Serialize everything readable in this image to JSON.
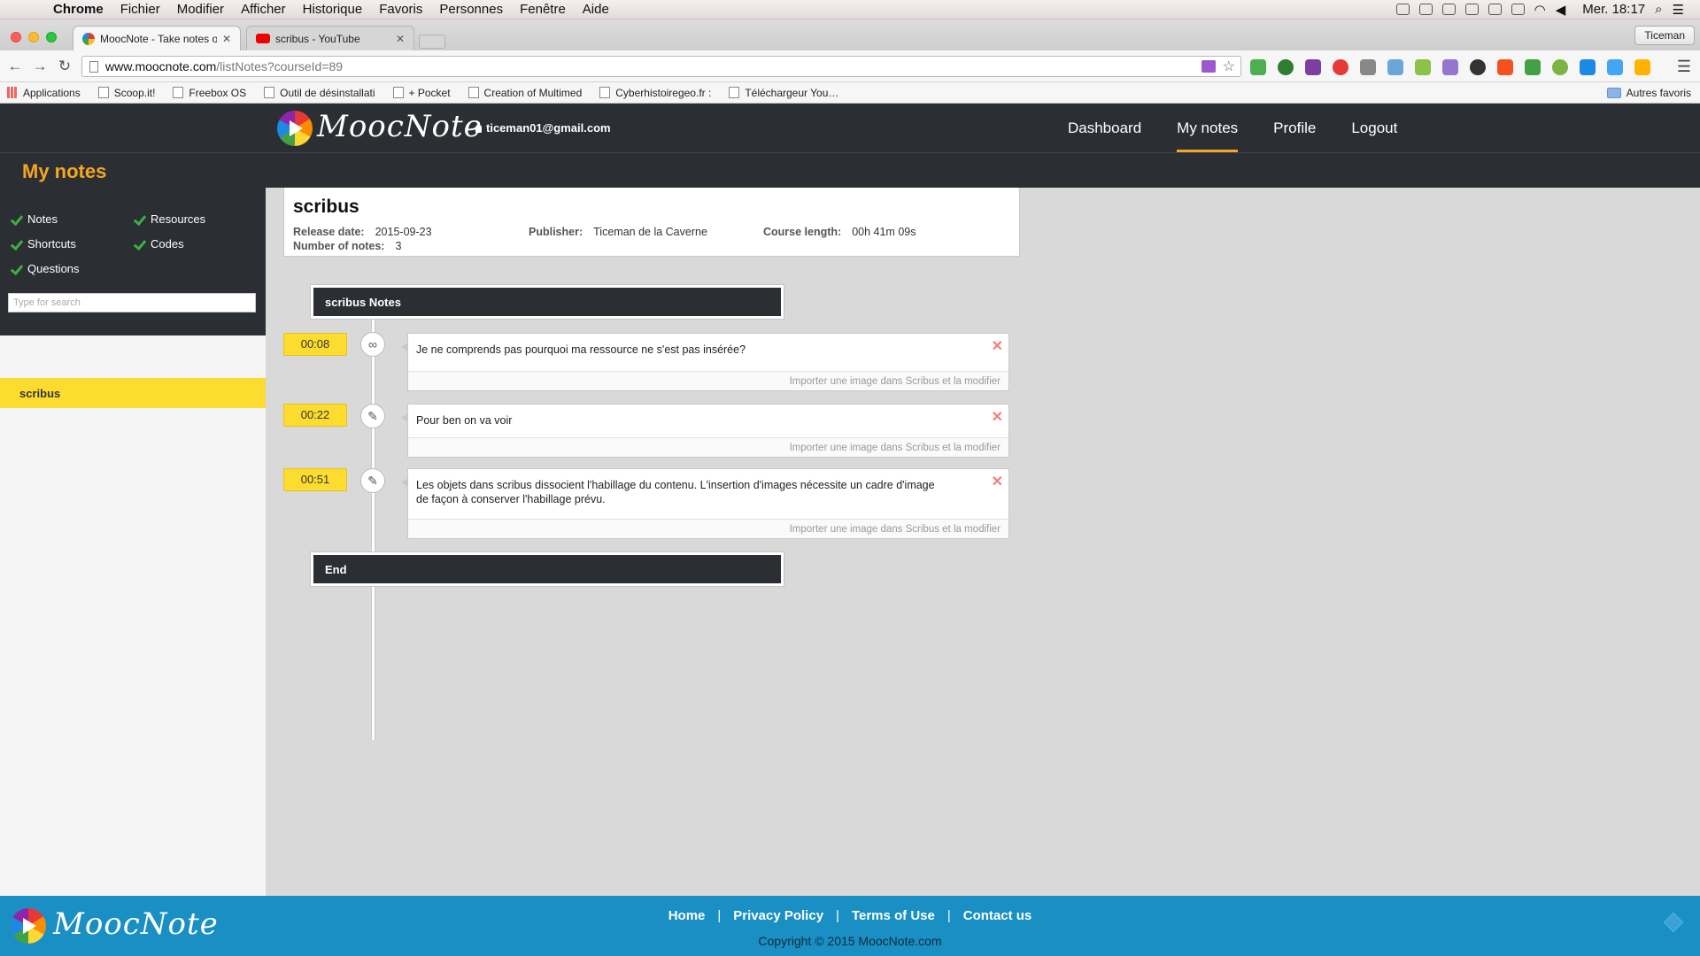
{
  "mac_menu": {
    "app_name": "Chrome",
    "items": [
      "Fichier",
      "Modifier",
      "Afficher",
      "Historique",
      "Favoris",
      "Personnes",
      "Fenêtre",
      "Aide"
    ],
    "clock": "Mer. 18:17"
  },
  "browser": {
    "tabs": [
      {
        "title": "MoocNote - Take notes on",
        "active": true
      },
      {
        "title": "scribus - YouTube",
        "active": false
      }
    ],
    "profile_name": "Ticeman",
    "url_host": "www.moocnote.com",
    "url_path": "/listNotes?courseId=89",
    "bookmarks": [
      "Applications",
      "Scoop.it!",
      "Freebox OS",
      "Outil de désinstallati",
      "+ Pocket",
      "Creation of Multimed",
      "Cyberhistoiregeo.fr :",
      "Téléchargeur YouTub"
    ],
    "bookmarks_right": "Autres favoris"
  },
  "header": {
    "logo_text": "MoocNote",
    "user_email": "ticeman01@gmail.com",
    "nav": [
      {
        "label": "Dashboard",
        "active": false
      },
      {
        "label": "My notes",
        "active": true
      },
      {
        "label": "Profile",
        "active": false
      },
      {
        "label": "Logout",
        "active": false
      }
    ]
  },
  "page_title": "My notes",
  "sidebar": {
    "filters": {
      "notes": "Notes",
      "resources": "Resources",
      "shortcuts": "Shortcuts",
      "codes": "Codes",
      "questions": "Questions"
    },
    "search_placeholder": "Type for search",
    "course_item": "scribus"
  },
  "course": {
    "title": "scribus",
    "release_label": "Release date:",
    "release_value": "2015-09-23",
    "publisher_label": "Publisher:",
    "publisher_value": "Ticeman de la Caverne",
    "length_label": "Course length:",
    "length_value": "00h 41m 09s",
    "notes_count_label": "Number of notes:",
    "notes_count_value": "3"
  },
  "timeline": {
    "header": "scribus Notes",
    "end": "End",
    "notes": [
      {
        "time": "00:08",
        "type_icon": "link-icon",
        "text": "Je ne comprends pas pourquoi ma ressource ne s'est pas insérée?",
        "footer": "Importer une image dans Scribus et la modifier"
      },
      {
        "time": "00:22",
        "type_icon": "pencil-icon",
        "text": "Pour ben on va voir",
        "footer": "Importer une image dans Scribus et la modifier"
      },
      {
        "time": "00:51",
        "type_icon": "pencil-icon",
        "text": "Les objets dans scribus dissocient l'habillage du contenu. L'insertion d'images nécessite un cadre d'image de façon à conserver l'habillage prévu.",
        "footer": "Importer une image dans Scribus et la modifier"
      }
    ]
  },
  "footer": {
    "logo_text": "MoocNote",
    "links": [
      "Home",
      "Privacy Policy",
      "Terms of Use",
      "Contact us"
    ],
    "copyright": "Copyright © 2015 MoocNote.com"
  },
  "colors": {
    "header_bg": "#2b2f33",
    "accent_orange": "#f5a623",
    "highlight_yellow": "#fcdc2e",
    "footer_blue": "#1a8fc4"
  }
}
